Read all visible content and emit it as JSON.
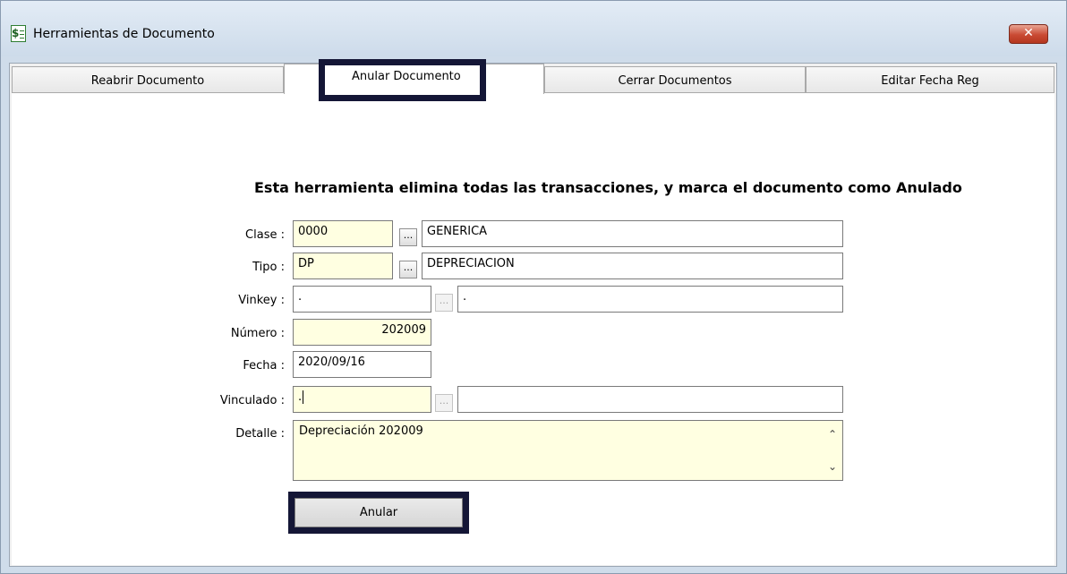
{
  "window": {
    "title": "Herramientas de Documento",
    "close_glyph": "✕"
  },
  "tabs": [
    {
      "label": "Reabrir Documento",
      "active": false
    },
    {
      "label": "Anular Documento",
      "active": true
    },
    {
      "label": "Cerrar Documentos",
      "active": false
    },
    {
      "label": "Editar Fecha Reg",
      "active": false
    }
  ],
  "panel": {
    "heading": "Esta herramienta elimina todas las transacciones, y marca el documento como Anulado"
  },
  "form": {
    "clase": {
      "label": "Clase :",
      "code": "0000",
      "desc": "GENERICA"
    },
    "tipo": {
      "label": "Tipo :",
      "code": "DP",
      "desc": "DEPRECIACION"
    },
    "vinkey": {
      "label": "Vinkey :",
      "code": ".",
      "desc": "."
    },
    "numero": {
      "label": "Número :",
      "value": "202009"
    },
    "fecha": {
      "label": "Fecha :",
      "value": "2020/09/16"
    },
    "vinculado": {
      "label": "Vinculado :",
      "code": ".",
      "desc": ""
    },
    "detalle": {
      "label": "Detalle :",
      "value": "Depreciación 202009"
    },
    "lookup_glyph": "..."
  },
  "actions": {
    "anular_label": "Anular"
  },
  "colors": {
    "highlight": "#141636",
    "field_yellow": "#ffffe1"
  }
}
